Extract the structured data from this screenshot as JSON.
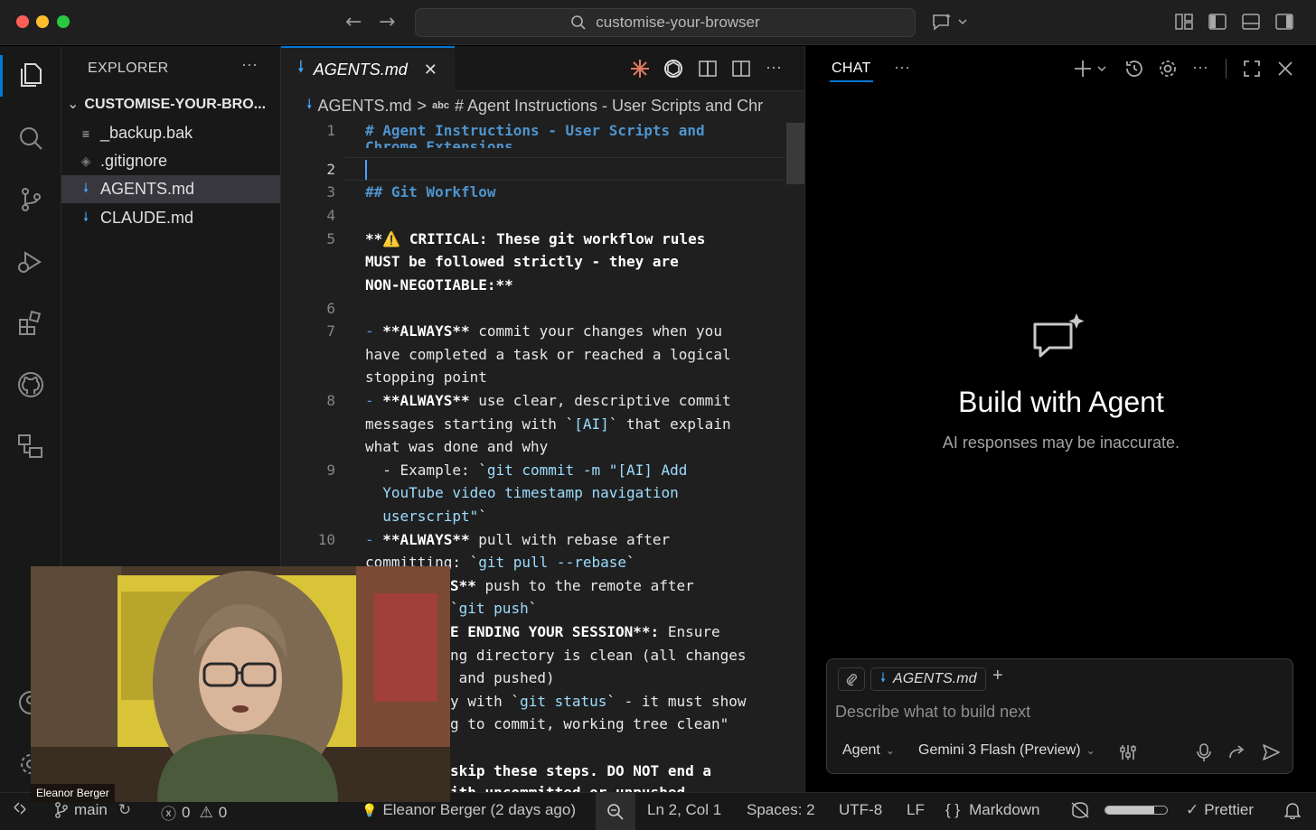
{
  "window": {
    "search_text": "customise-your-browser",
    "traffic_colors": [
      "#ff5f57",
      "#febc2e",
      "#28c840"
    ]
  },
  "explorer": {
    "title": "EXPLORER",
    "more": "···",
    "folder": "CUSTOMISE-YOUR-BRO...",
    "files": [
      {
        "name": "_backup.bak",
        "icon": "lines-icon"
      },
      {
        "name": ".gitignore",
        "icon": "git-diamond-icon"
      },
      {
        "name": "AGENTS.md",
        "icon": "markdown-arrow-icon",
        "selected": true
      },
      {
        "name": "CLAUDE.md",
        "icon": "markdown-arrow-icon"
      }
    ]
  },
  "editor": {
    "tab_label": "AGENTS.md",
    "more": "···",
    "breadcrumb_file": "AGENTS.md",
    "breadcrumb_sep": ">",
    "breadcrumb_abc": "abc",
    "breadcrumb_symbol": "# Agent Instructions - User Scripts and Chr",
    "line_numbers": [
      "1",
      "2",
      "3",
      "4",
      "5",
      "6",
      "7",
      "8",
      "9",
      "10"
    ],
    "lines": {
      "l1a": "# Agent Instructions - User Scripts and",
      "l1b": "Chrome Extensions",
      "l3": "## Git Workflow",
      "l5a_pre": "**",
      "l5a_warn": "⚠️",
      "l5a": " CRITICAL: These git workflow rules",
      "l5b": "MUST be followed strictly - they are",
      "l5c": "NON-NEGOTIABLE:**",
      "l7a_dash": "- ",
      "l7a_b": "**ALWAYS**",
      "l7a": " commit your changes when you",
      "l7b": "have completed a task or reached a logical",
      "l7c": "stopping point",
      "l8a_dash": "- ",
      "l8a_b": "**ALWAYS**",
      "l8a": " use clear, descriptive commit",
      "l8b_pre": "messages starting with `",
      "l8b_code": "[AI]",
      "l8b_post": "` that explain",
      "l8c": "what was done and why",
      "l9a_pre": "  - Example: `",
      "l9a_code": "git commit -m \"[AI] Add",
      "l9b_code": "  YouTube video timestamp navigation",
      "l9c_code": "  userscript\"",
      "l9c_post": "`",
      "l10a_dash": "- ",
      "l10a_b": "**ALWAYS**",
      "l10a": " pull with rebase after",
      "l10b_pre": "committing: `",
      "l10b_code": "git pull --rebase",
      "l10b_post": "`",
      "l11a_b": "S**",
      "l11a": " push to the remote after",
      "l11b_pre": "`",
      "l11b_code": "git push",
      "l11b_post": "`",
      "l12a_b": "E ENDING YOUR SESSION**:",
      "l12a": " Ensure",
      "l12b": "ng directory is clean (all changes",
      "l12c": " and pushed)",
      "l12d_pre": "y with `",
      "l12d_code": "git status",
      "l12d_post": "` - it must show",
      "l12e": "g to commit, working tree clean\"",
      "l13a": "skip these steps. DO NOT end a",
      "l13b": "ith uncommitted or unpushed"
    }
  },
  "chat": {
    "title": "CHAT",
    "more": "···",
    "heading": "Build with Agent",
    "subtitle": "AI responses may be inaccurate.",
    "context_file": "AGENTS.md",
    "placeholder": "Describe what to build next",
    "mode": "Agent",
    "model": "Gemini 3 Flash (Preview)"
  },
  "status": {
    "branch": "main",
    "errors": "0",
    "warnings": "0",
    "blame": "Eleanor Berger (2 days ago)",
    "position": "Ln 2, Col 1",
    "spaces": "Spaces: 2",
    "encoding": "UTF-8",
    "eol": "LF",
    "braces": "{ }",
    "language": "Markdown",
    "formatter": "Prettier"
  },
  "video": {
    "name": "Eleanor Berger"
  }
}
